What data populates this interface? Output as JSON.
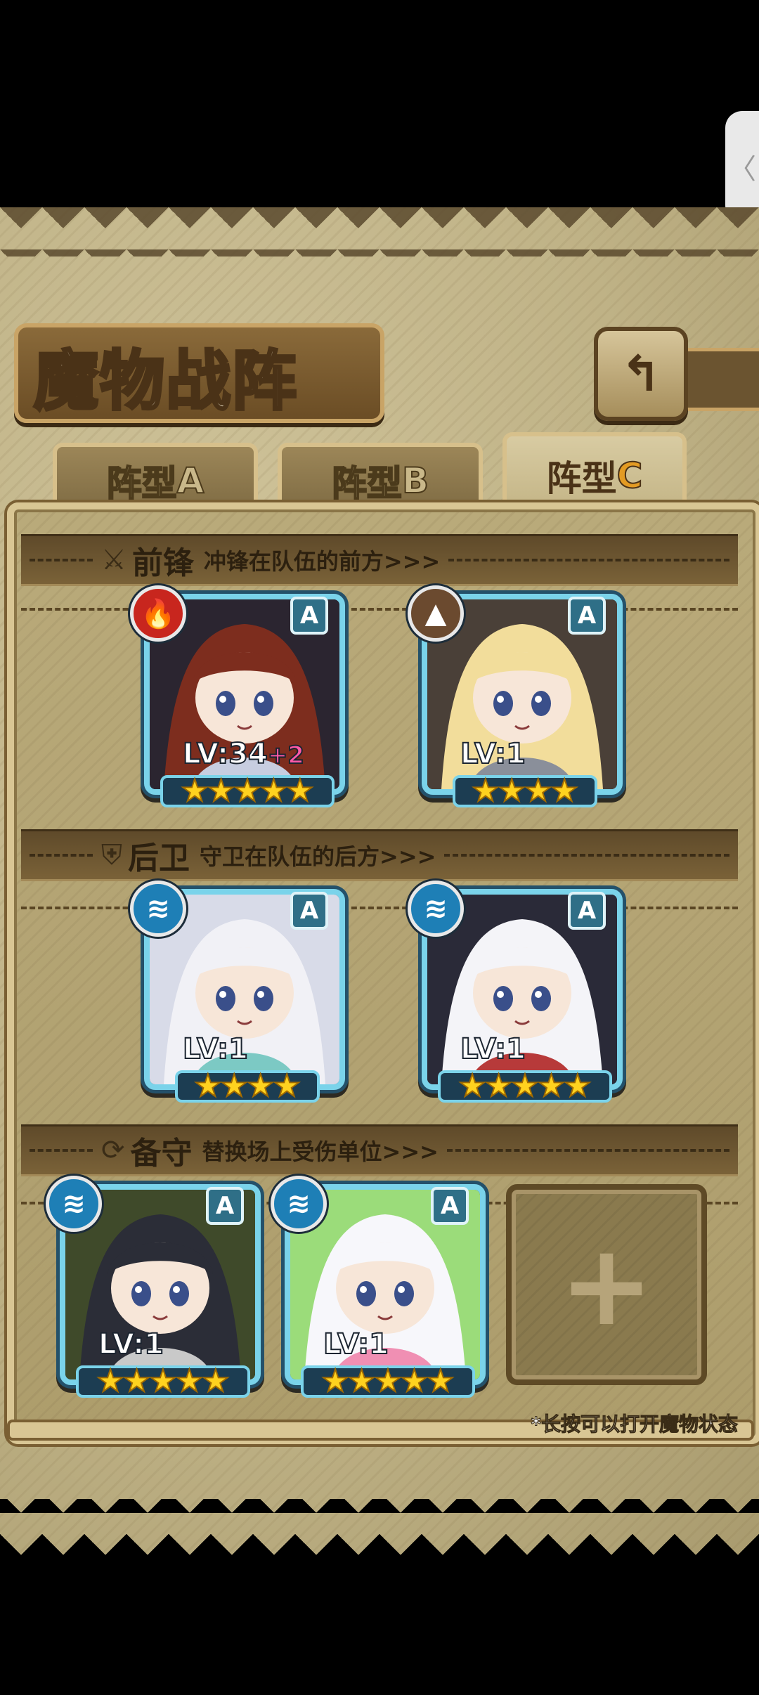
{
  "page": {
    "title": "魔物战阵",
    "back_icon": "back-arrow-icon",
    "side_tab_glyph": "〈",
    "hint": "*长按可以打开魔物状态"
  },
  "tabs": [
    {
      "label": "阵型",
      "letter": "A",
      "active": false
    },
    {
      "label": "阵型",
      "letter": "B",
      "active": false
    },
    {
      "label": "阵型",
      "letter": "C",
      "active": true
    }
  ],
  "sections": {
    "front": {
      "icon": "sword-icon",
      "title": "前锋",
      "desc": "冲锋在队伍的前方>>>"
    },
    "rear": {
      "icon": "shield-icon",
      "title": "后卫",
      "desc": "守卫在队伍的后方>>>"
    },
    "reserve": {
      "icon": "swap-icon",
      "title": "备守",
      "desc": "替换场上受伤单位>>>"
    }
  },
  "front_units": [
    {
      "rank": "A",
      "element": "fire",
      "element_color": "#c8261e",
      "level": "LV:34",
      "bonus": "+2",
      "stars": 5,
      "art_colors": [
        "#7d2d1e",
        "#c7cde0",
        "#2b2530"
      ]
    },
    {
      "rank": "A",
      "element": "earth",
      "element_color": "#6b4a2f",
      "level": "LV:1",
      "bonus": "",
      "stars": 4,
      "art_colors": [
        "#f2dd9b",
        "#8a8f9a",
        "#4a4038"
      ]
    }
  ],
  "rear_units": [
    {
      "rank": "A",
      "element": "water",
      "element_color": "#1e7fb6",
      "level": "LV:1",
      "bonus": "",
      "stars": 4,
      "art_colors": [
        "#f1f1f6",
        "#7cc9c4",
        "#d8dbe8"
      ]
    },
    {
      "rank": "A",
      "element": "water",
      "element_color": "#1e7fb6",
      "level": "LV:1",
      "bonus": "",
      "stars": 5,
      "art_colors": [
        "#f4f4f8",
        "#b73a3a",
        "#2a2a38"
      ]
    }
  ],
  "reserve_units": [
    {
      "rank": "A",
      "element": "water",
      "element_color": "#1e7fb6",
      "level": "LV:1",
      "bonus": "",
      "stars": 5,
      "art_colors": [
        "#2b2d37",
        "#c9c9c9",
        "#3f4a2a"
      ]
    },
    {
      "rank": "A",
      "element": "water",
      "element_color": "#1e7fb6",
      "level": "LV:1",
      "bonus": "",
      "stars": 5,
      "art_colors": [
        "#f7f7fb",
        "#f08fb3",
        "#9bdc7a"
      ]
    }
  ],
  "empty_slot": {
    "glyph": "+"
  },
  "element_glyphs": {
    "fire": "🔥",
    "earth": "▲",
    "water": "≋"
  }
}
